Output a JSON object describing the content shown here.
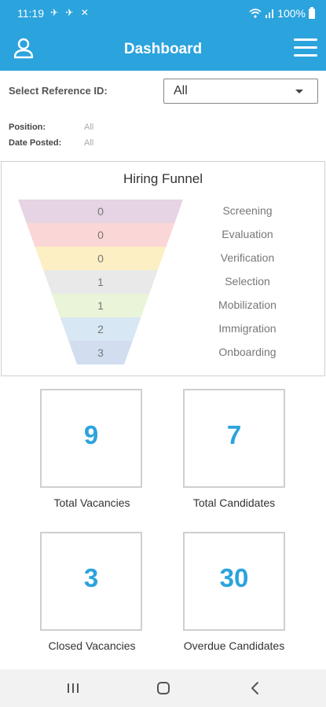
{
  "status": {
    "time": "11:19",
    "notif_icons": "✈ ✈ ✕",
    "battery": "100%"
  },
  "header": {
    "title": "Dashboard"
  },
  "filter": {
    "ref_label": "Select Reference ID:",
    "ref_value": "All",
    "position_label": "Position:",
    "position_value": "All",
    "date_label": "Date Posted:",
    "date_value": "All"
  },
  "funnel": {
    "title": "Hiring Funnel",
    "stages": [
      {
        "name": "Screening",
        "value": 0,
        "color": "#e6d3e3"
      },
      {
        "name": "Evaluation",
        "value": 0,
        "color": "#fbd6d6"
      },
      {
        "name": "Verification",
        "value": 0,
        "color": "#fcefc4"
      },
      {
        "name": "Selection",
        "value": 1,
        "color": "#e9e9e9"
      },
      {
        "name": "Mobilization",
        "value": 1,
        "color": "#eaf4d8"
      },
      {
        "name": "Immigration",
        "value": 2,
        "color": "#d7e7f3"
      },
      {
        "name": "Onboarding",
        "value": 3,
        "color": "#d2def0"
      }
    ]
  },
  "stats": {
    "total_vacancies": {
      "value": "9",
      "label": "Total Vacancies"
    },
    "total_candidates": {
      "value": "7",
      "label": "Total Candidates"
    },
    "closed_vacancies": {
      "value": "3",
      "label": "Closed Vacancies"
    },
    "overdue_candidates": {
      "value": "30",
      "label": "Overdue Candidates"
    }
  },
  "colors": {
    "accent": "#2ba3dd"
  }
}
